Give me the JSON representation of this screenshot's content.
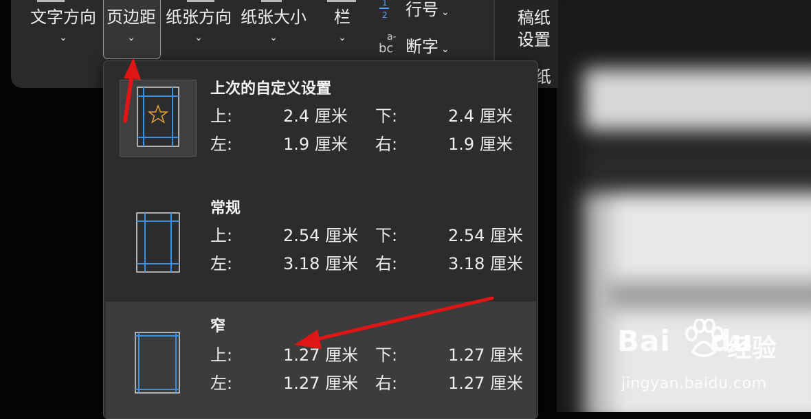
{
  "ribbon": {
    "text_direction": "文字方向",
    "margins": "页边距",
    "orientation": "纸张方向",
    "size": "纸张大小",
    "columns": "栏",
    "line_numbers": "行号",
    "hyphenation": "断字",
    "draft_line1": "稿纸",
    "draft_line2": "设置",
    "draft_group": "纸",
    "chevron": "⌄",
    "small_chevron": "˅"
  },
  "dropdown": {
    "options": [
      {
        "title": "上次的自定义设置",
        "top_label": "上:",
        "top_value": "2.4 厘米",
        "bottom_label": "下:",
        "bottom_value": "2.4 厘米",
        "left_label": "左:",
        "left_value": "1.9 厘米",
        "right_label": "右:",
        "right_value": "1.9 厘米"
      },
      {
        "title": "常规",
        "top_label": "上:",
        "top_value": "2.54 厘米",
        "bottom_label": "下:",
        "bottom_value": "2.54 厘米",
        "left_label": "左:",
        "left_value": "3.18 厘米",
        "right_label": "右:",
        "right_value": "3.18 厘米"
      },
      {
        "title": "窄",
        "top_label": "上:",
        "top_value": "1.27 厘米",
        "bottom_label": "下:",
        "bottom_value": "1.27 厘米",
        "left_label": "左:",
        "left_value": "1.27 厘米",
        "right_label": "右:",
        "right_value": "1.27 厘米"
      }
    ]
  },
  "icons": {
    "line_num_glyph": "1\n2",
    "hyphen_glyph": "a-\nbc"
  },
  "watermark": {
    "logo": "Bai",
    "logo2": "du",
    "brand": "经验",
    "url": "jingyan.baidu.com"
  },
  "colors": {
    "accent_blue": "#3d8fe0",
    "star_orange": "#e8a23a",
    "arrow_red": "#e01515"
  }
}
